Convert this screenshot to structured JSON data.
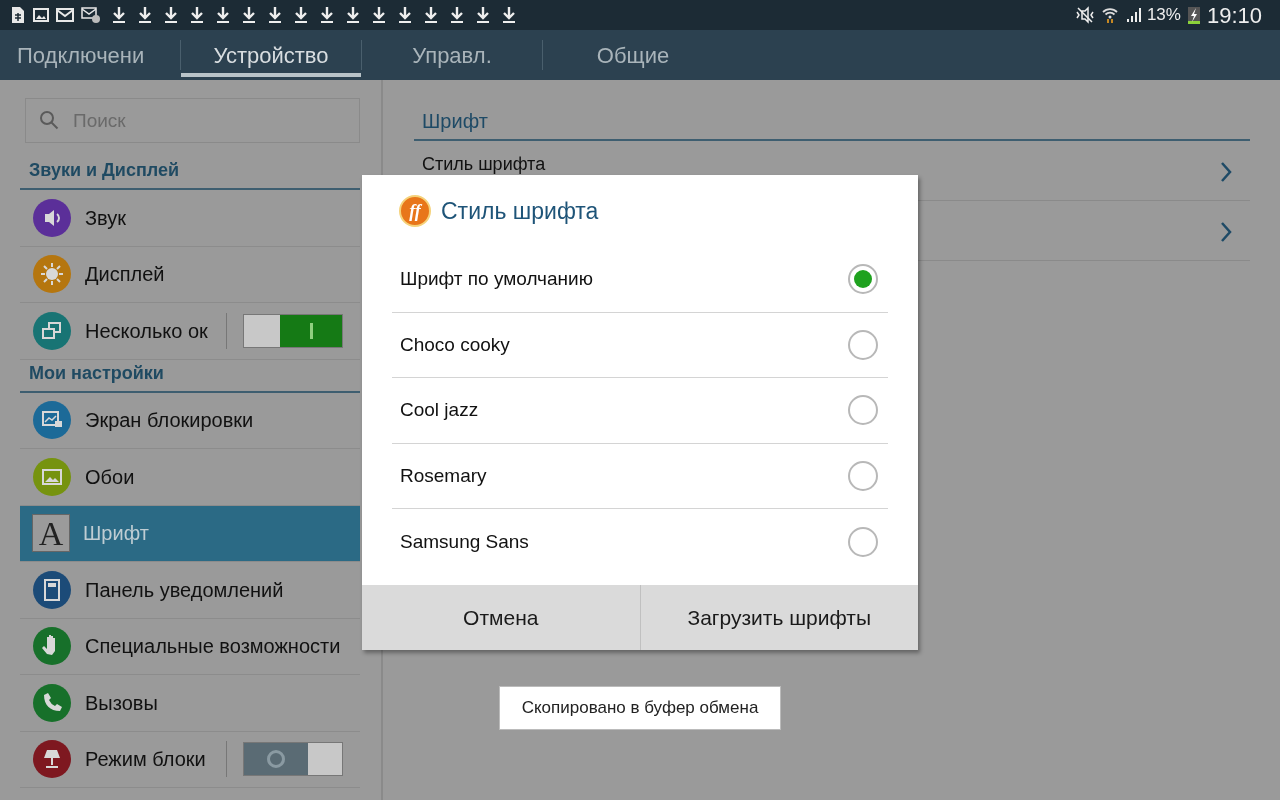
{
  "status_bar": {
    "battery": "13%",
    "time": "19:10"
  },
  "tabs": [
    {
      "label": "Подключени",
      "selected": false
    },
    {
      "label": "Устройство",
      "selected": true
    },
    {
      "label": "Управл.",
      "selected": false
    },
    {
      "label": "Общие",
      "selected": false
    }
  ],
  "search": {
    "placeholder": "Поиск"
  },
  "sidebar": [
    {
      "header": "Звуки и Дисплей",
      "items": [
        {
          "label": "Звук",
          "color": "#5b2f99",
          "selected": false
        },
        {
          "label": "Дисплей",
          "color": "#b5760f",
          "selected": false
        },
        {
          "label": "Несколько ок",
          "color": "#187474",
          "selected": false,
          "kind": "toggle",
          "on": true
        }
      ]
    },
    {
      "header": "Мои настройки",
      "items": [
        {
          "label": "Экран блокировки",
          "color": "#1c6a98",
          "selected": false
        },
        {
          "label": "Обои",
          "color": "#76930f",
          "selected": false
        },
        {
          "label": "Шрифт",
          "selected": true,
          "kind": "tile",
          "glyph": "A"
        },
        {
          "label": "Панель уведомлений",
          "color": "#1c4b78",
          "selected": false
        },
        {
          "label": "Специальные возможности",
          "color": "#17702a",
          "selected": false
        },
        {
          "label": "Вызовы",
          "color": "#17702a",
          "selected": false
        },
        {
          "label": "Режим блоки",
          "color": "#7e1820",
          "selected": false,
          "kind": "toggle",
          "on": false
        }
      ]
    }
  ],
  "content": {
    "header": "Шрифт",
    "rows": [
      {
        "label": "Стиль шрифта"
      },
      {}
    ]
  },
  "dialog": {
    "glyph": "ff",
    "title": "Стиль шрифта",
    "options": [
      {
        "label": "Шрифт по умолчанию",
        "selected": true
      },
      {
        "label": "Choco cooky",
        "selected": false
      },
      {
        "label": "Cool jazz",
        "selected": false
      },
      {
        "label": "Rosemary",
        "selected": false
      },
      {
        "label": "Samsung Sans",
        "selected": false
      }
    ],
    "buttons": [
      "Отмена",
      "Загрузить шрифты"
    ]
  },
  "toast": "Скопировано в буфер обмена"
}
